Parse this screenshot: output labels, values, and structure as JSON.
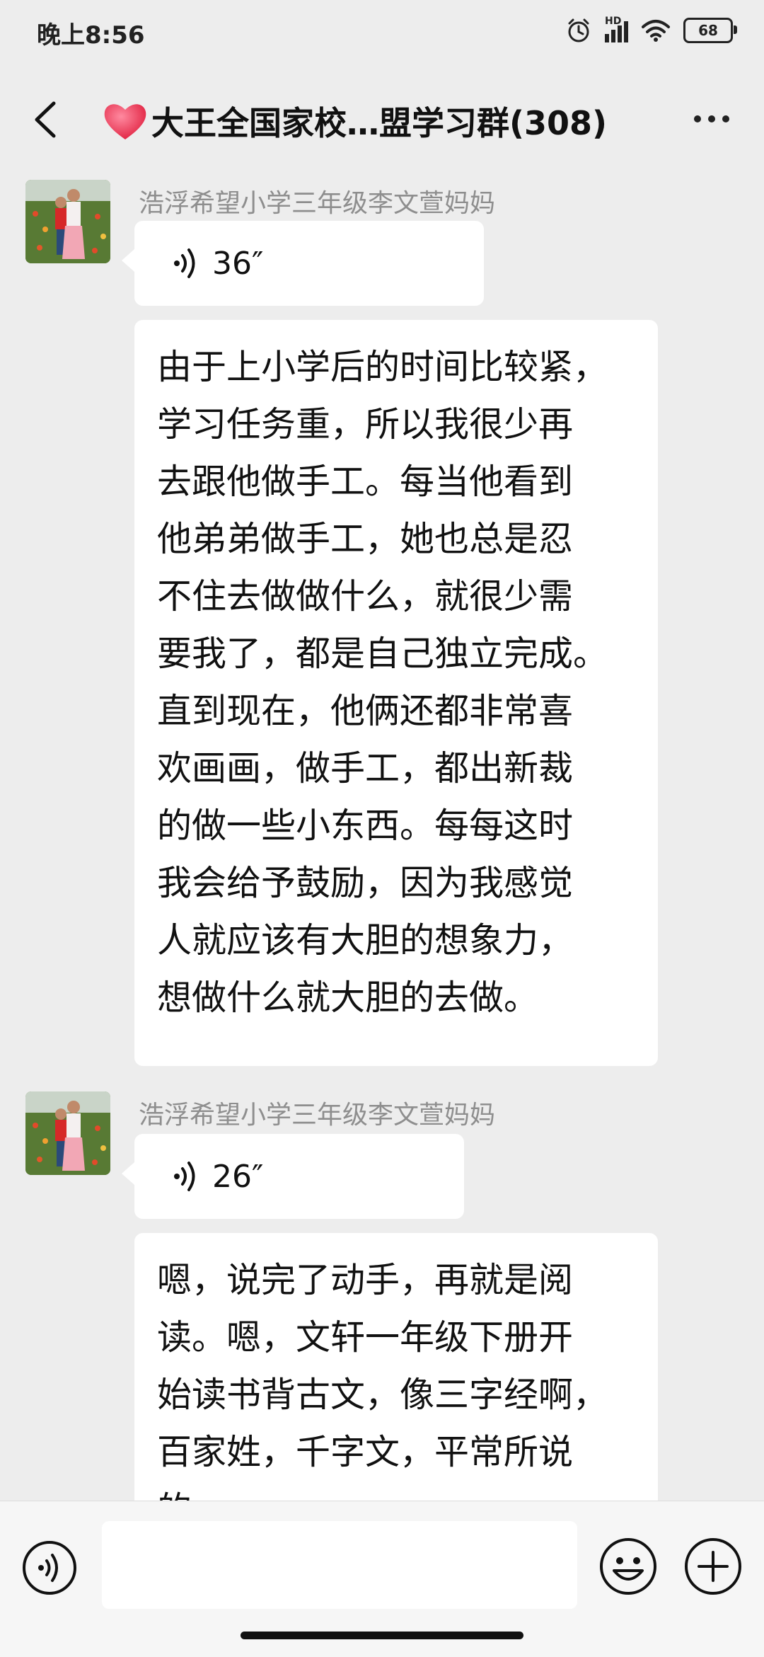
{
  "status_bar": {
    "time": "晚上8:56",
    "network_label": "HD",
    "battery_level": "68",
    "icons": [
      "alarm-icon",
      "signal-icon",
      "wifi-icon",
      "battery-icon"
    ]
  },
  "header": {
    "emoji": "❤️",
    "title": "大王全国家校…盟学习群(308)"
  },
  "messages": [
    {
      "sender": "浩浮希望小学三年级李文萱妈妈",
      "voice_duration": "36″",
      "text": [
        "由于上小学后的时间比较紧，",
        "学习任务重，所以我很少再",
        "去跟他做手工。每当他看到",
        "他弟弟做手工，她也总是忍",
        "不住去做做什么，就很少需",
        "要我了，都是自己独立完成。",
        "直到现在，他俩还都非常喜",
        "欢画画，做手工，都出新裁",
        "的做一些小东西。每每这时",
        "我会给予鼓励，因为我感觉",
        "人就应该有大胆的想象力，",
        "想做什么就大胆的去做。"
      ]
    },
    {
      "sender": "浩浮希望小学三年级李文萱妈妈",
      "voice_duration": "26″",
      "text": [
        "嗯，说完了动手，再就是阅",
        "读。嗯，文轩一年级下册开",
        "始读书背古文，像三字经啊，",
        "百家姓，千字文，平常所说",
        "的……"
      ]
    }
  ],
  "input_bar": {
    "placeholder": ""
  },
  "colors": {
    "background": "#ededed",
    "bubble": "#ffffff",
    "sender_text": "#8e8e8e"
  }
}
